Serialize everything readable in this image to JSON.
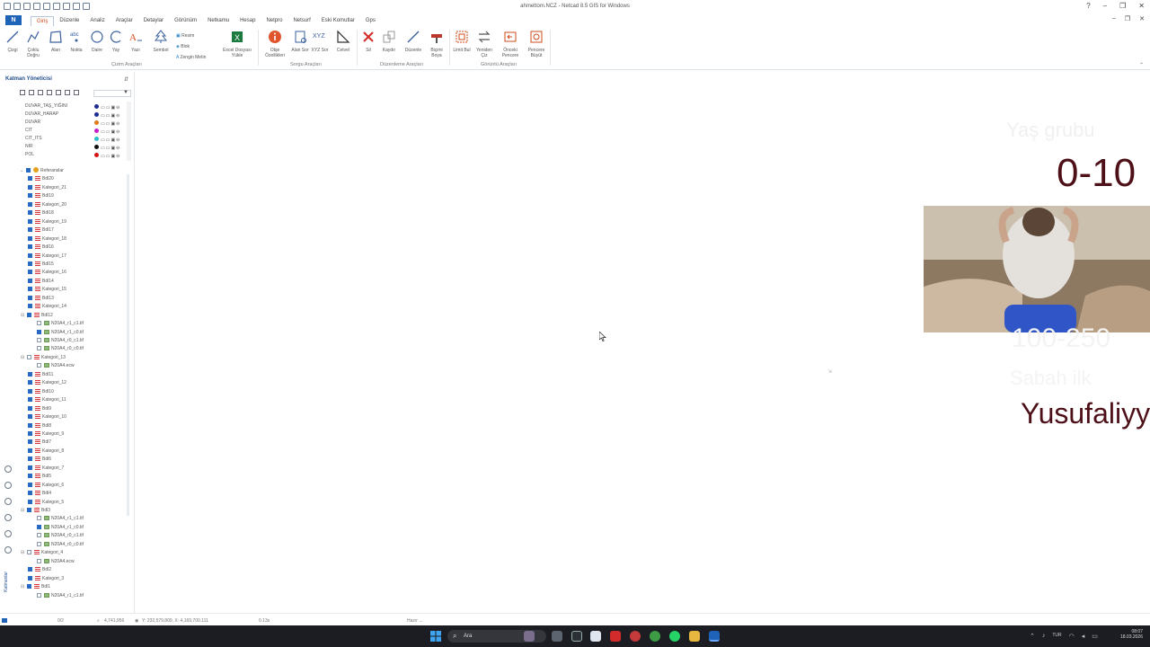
{
  "window": {
    "title": "ahmettom.NCZ - Netcad 8.5 GIS for Windows",
    "controls": [
      "?",
      "–",
      "❐",
      "✕"
    ],
    "mdi_controls": [
      "–",
      "❐",
      "✕"
    ]
  },
  "menu": {
    "app_button": "N",
    "items": [
      "Giriş",
      "Düzenle",
      "Analiz",
      "Araçlar",
      "Detaylar",
      "Görünüm",
      "Netkamu",
      "Hesap",
      "Netpro",
      "Netsurf",
      "Eski Komutlar",
      "Gps"
    ],
    "active": "Giriş"
  },
  "ribbon": {
    "draw_tools": [
      {
        "label": "Çizgi",
        "icon": "line-icon"
      },
      {
        "label": "Çoklu Doğru",
        "icon": "polyline-icon"
      },
      {
        "label": "Alan",
        "icon": "area-icon"
      },
      {
        "label": "Nokta",
        "icon": "point-icon"
      },
      {
        "label": "Daire",
        "icon": "circle-icon"
      },
      {
        "label": "Yay",
        "icon": "arc-icon"
      },
      {
        "label": "Yazı",
        "icon": "text-icon"
      },
      {
        "label": "Sembol",
        "icon": "symbol-icon"
      }
    ],
    "small_tools": [
      "Resim",
      "Blok",
      "Zengin Metin"
    ],
    "excel_button": "Excel Dosyası Yükle",
    "group_draw": "Çizim Araçları",
    "query_tools": [
      {
        "label": "Obje Özellikleri",
        "icon": "info-icon"
      },
      {
        "label": "Alan Sor",
        "icon": "area-query-icon"
      },
      {
        "label": "XYZ Sor",
        "icon": "xyz-icon"
      },
      {
        "label": "Cetvel",
        "icon": "ruler-icon"
      }
    ],
    "group_query": "Sorgu Araçları",
    "edit_tools": [
      {
        "label": "Sil",
        "icon": "delete-icon"
      },
      {
        "label": "Kaydır",
        "icon": "move-icon"
      },
      {
        "label": "Düzenle",
        "icon": "edit-icon"
      },
      {
        "label": "Biçimi Boya",
        "icon": "format-paint-icon"
      }
    ],
    "group_edit": "Düzenleme Araçları",
    "view_tools": [
      {
        "label": "Limit Bul",
        "icon": "limits-icon"
      },
      {
        "label": "Yeniden Çiz",
        "icon": "redraw-icon"
      },
      {
        "label": "Önceki Pencere",
        "icon": "previous-window-icon"
      },
      {
        "label": "Pencere Büyüt",
        "icon": "zoom-window-icon"
      }
    ],
    "group_view": "Görüntü Araçları"
  },
  "layer_panel": {
    "title": "Katman Yöneticisi",
    "pin": "⇵",
    "layers": [
      {
        "name": "DUVAR_TAŞ_YIĞINI",
        "color": "#1e2b8f"
      },
      {
        "name": "DUVAR_HARAP",
        "color": "#1e2b8f"
      },
      {
        "name": "DUVAR",
        "color": "#e07b18"
      },
      {
        "name": "CIT",
        "color": "#c621c9"
      },
      {
        "name": "CIT_ITS",
        "color": "#2fc1c9"
      },
      {
        "name": "NIR",
        "color": "#111111"
      },
      {
        "name": "POL",
        "color": "#d71414"
      }
    ],
    "tree_root": "Referanslar",
    "tree": [
      {
        "name": "Bdl20",
        "kind": "layer",
        "level": 1,
        "checked": true
      },
      {
        "name": "Kategori_21",
        "kind": "layer",
        "level": 1,
        "checked": true
      },
      {
        "name": "Bdl19",
        "kind": "layer",
        "level": 1,
        "checked": true
      },
      {
        "name": "Kategori_20",
        "kind": "layer",
        "level": 1,
        "checked": true
      },
      {
        "name": "Bdl18",
        "kind": "layer",
        "level": 1,
        "checked": true
      },
      {
        "name": "Kategori_19",
        "kind": "layer",
        "level": 1,
        "checked": true
      },
      {
        "name": "Bdl17",
        "kind": "layer",
        "level": 1,
        "checked": true
      },
      {
        "name": "Kategori_18",
        "kind": "layer",
        "level": 1,
        "checked": true
      },
      {
        "name": "Bdl16",
        "kind": "layer",
        "level": 1,
        "checked": true
      },
      {
        "name": "Kategori_17",
        "kind": "layer",
        "level": 1,
        "checked": true
      },
      {
        "name": "Bdl15",
        "kind": "layer",
        "level": 1,
        "checked": true
      },
      {
        "name": "Kategori_16",
        "kind": "layer",
        "level": 1,
        "checked": true
      },
      {
        "name": "Bdl14",
        "kind": "layer",
        "level": 1,
        "checked": true
      },
      {
        "name": "Kategori_15",
        "kind": "layer",
        "level": 1,
        "checked": true
      },
      {
        "name": "Bdl13",
        "kind": "layer",
        "level": 1,
        "checked": true
      },
      {
        "name": "Kategori_14",
        "kind": "layer",
        "level": 1,
        "checked": true
      },
      {
        "name": "Bdl12",
        "kind": "layer",
        "level": 1,
        "checked": true,
        "expanded": true
      },
      {
        "name": "N20A4_r1_c1.tif",
        "kind": "tif",
        "level": 2,
        "checked": false
      },
      {
        "name": "N20A4_r1_c0.tif",
        "kind": "tif",
        "level": 2,
        "checked": true
      },
      {
        "name": "N20A4_r0_c1.tif",
        "kind": "tif",
        "level": 2,
        "checked": false
      },
      {
        "name": "N20A4_r0_c0.tif",
        "kind": "tif",
        "level": 2,
        "checked": false
      },
      {
        "name": "Kategori_13",
        "kind": "layer",
        "level": 1,
        "checked": false,
        "expanded": true
      },
      {
        "name": "N20A4.ecw",
        "kind": "tif",
        "level": 2,
        "checked": false
      },
      {
        "name": "Bdl11",
        "kind": "layer",
        "level": 1,
        "checked": true
      },
      {
        "name": "Kategori_12",
        "kind": "layer",
        "level": 1,
        "checked": true
      },
      {
        "name": "Bdl10",
        "kind": "layer",
        "level": 1,
        "checked": true
      },
      {
        "name": "Kategori_11",
        "kind": "layer",
        "level": 1,
        "checked": true
      },
      {
        "name": "Bdl9",
        "kind": "layer",
        "level": 1,
        "checked": true
      },
      {
        "name": "Kategori_10",
        "kind": "layer",
        "level": 1,
        "checked": true
      },
      {
        "name": "Bdl8",
        "kind": "layer",
        "level": 1,
        "checked": true
      },
      {
        "name": "Kategori_9",
        "kind": "layer",
        "level": 1,
        "checked": true
      },
      {
        "name": "Bdl7",
        "kind": "layer",
        "level": 1,
        "checked": true
      },
      {
        "name": "Kategori_8",
        "kind": "layer",
        "level": 1,
        "checked": true
      },
      {
        "name": "Bdl6",
        "kind": "layer",
        "level": 1,
        "checked": true
      },
      {
        "name": "Kategori_7",
        "kind": "layer",
        "level": 1,
        "checked": true
      },
      {
        "name": "Bdl5",
        "kind": "layer",
        "level": 1,
        "checked": true
      },
      {
        "name": "Kategori_6",
        "kind": "layer",
        "level": 1,
        "checked": true
      },
      {
        "name": "Bdl4",
        "kind": "layer",
        "level": 1,
        "checked": true
      },
      {
        "name": "Kategori_5",
        "kind": "layer",
        "level": 1,
        "checked": true
      },
      {
        "name": "Bdl3",
        "kind": "layer",
        "level": 1,
        "checked": true,
        "expanded": true
      },
      {
        "name": "N20A4_r1_c1.tif",
        "kind": "tif",
        "level": 2,
        "checked": false
      },
      {
        "name": "N20A4_r1_c0.tif",
        "kind": "tif",
        "level": 2,
        "checked": true
      },
      {
        "name": "N20A4_r0_c1.tif",
        "kind": "tif",
        "level": 2,
        "checked": false
      },
      {
        "name": "N20A4_r0_c0.tif",
        "kind": "tif",
        "level": 2,
        "checked": false
      },
      {
        "name": "Kategori_4",
        "kind": "layer",
        "level": 1,
        "checked": false,
        "expanded": true
      },
      {
        "name": "N20A4.ecw",
        "kind": "tif",
        "level": 2,
        "checked": false
      },
      {
        "name": "Bdl2",
        "kind": "layer",
        "level": 1,
        "checked": true
      },
      {
        "name": "Kategori_3",
        "kind": "layer",
        "level": 1,
        "checked": true
      },
      {
        "name": "Bdl1",
        "kind": "layer",
        "level": 1,
        "checked": true,
        "expanded": true
      },
      {
        "name": "N20A4_r1_c1.tif",
        "kind": "tif",
        "level": 2,
        "checked": false
      }
    ],
    "rail_label": "Katmanlar"
  },
  "overlay": {
    "range": "0-10",
    "name": "Yusufaliyy",
    "faded_top": "Yaş grubu",
    "faded_mid": "100-250",
    "faded_low": "Sabah ilk"
  },
  "status": {
    "layer": "0/2",
    "zoom": "4,741,956",
    "coords": "Y: 232,579.809, X: 4,169,700.111",
    "time": "0.13s",
    "ready": "Hazır ..."
  },
  "taskbar": {
    "search": "Ara",
    "lang": "TUR",
    "time": "08:07",
    "date": "18.03.2026"
  }
}
